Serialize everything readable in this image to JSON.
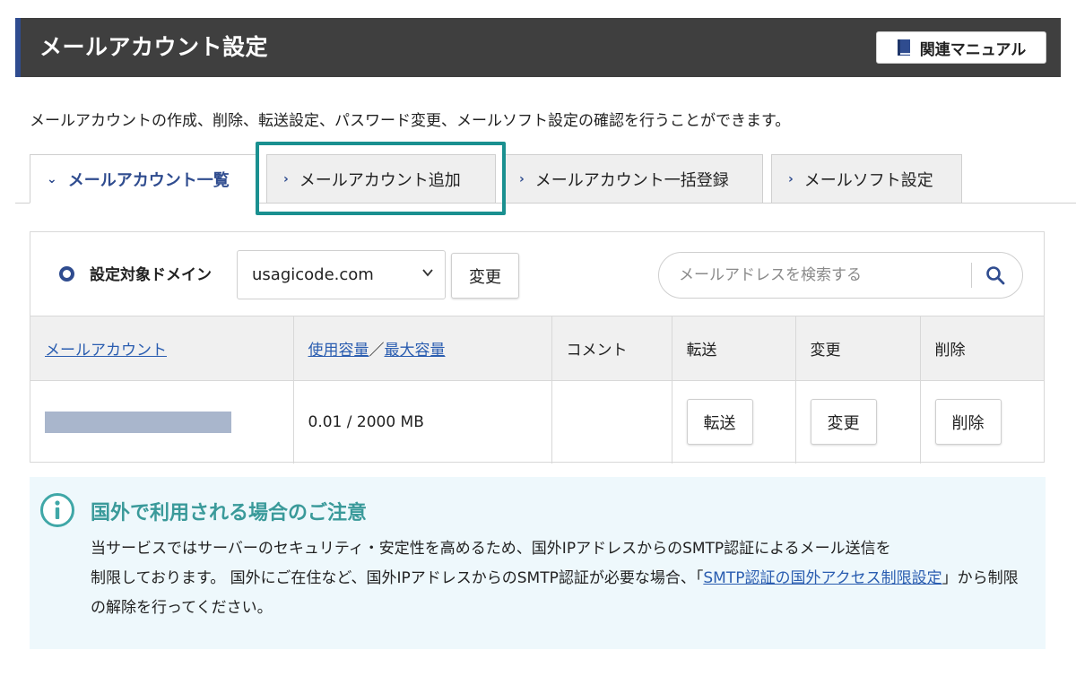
{
  "header": {
    "title": "メールアカウント設定",
    "manual_button": "関連マニュアル",
    "manual_icon": "book-icon"
  },
  "description": "メールアカウントの作成、削除、転送設定、パスワード変更、メールソフト設定の確認を行うことができます。",
  "tabs": [
    {
      "label": "メールアカウント一覧",
      "active": true
    },
    {
      "label": "メールアカウント追加",
      "active": false,
      "highlighted": true
    },
    {
      "label": "メールアカウント一括登録",
      "active": false
    },
    {
      "label": "メールソフト設定",
      "active": false
    }
  ],
  "domain": {
    "label": "設定対象ドメイン",
    "selected": "usagicode.com",
    "change_button": "変更"
  },
  "search": {
    "placeholder": "メールアドレスを検索する",
    "icon": "search-icon"
  },
  "table": {
    "headers": {
      "account": "メールアカウント",
      "used": "使用容量",
      "separator": "／",
      "max": "最大容量",
      "comment": "コメント",
      "forward": "転送",
      "change": "変更",
      "delete": "削除"
    },
    "rows": [
      {
        "account": "",
        "usage": "0.01 / 2000 MB",
        "comment": "",
        "forward_button": "転送",
        "change_button": "変更",
        "delete_button": "削除"
      }
    ]
  },
  "notice": {
    "title": "国外で利用される場合のご注意",
    "body_line1": "当サービスではサーバーのセキュリティ・安定性を高めるため、国外IPアドレスからのSMTP認証によるメール送信を",
    "body_line2_pre": "制限しております。 国外にご在住など、国外IPアドレスからのSMTP認証が必要な場合、「",
    "body_link": "SMTP認証の国外アクセス制限設定",
    "body_post": "」から制限の解除を行ってください。",
    "icon": "info-icon"
  },
  "colors": {
    "header_bg": "#3f3f3f",
    "accent_blue": "#2f4c8f",
    "link_blue": "#2a5db0",
    "highlight_teal": "#1a9090",
    "notice_bg": "#eef8fc"
  }
}
